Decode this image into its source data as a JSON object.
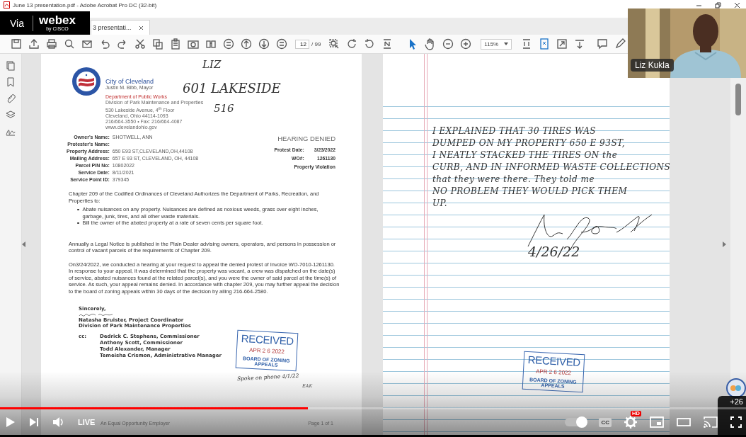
{
  "window": {
    "title": "June 13 presentation.pdf - Adobe Acrobat Pro DC (32-bit)"
  },
  "tab": {
    "label": "3 presentati..."
  },
  "toolbar": {
    "page_number": "12",
    "page_total": "/ 99",
    "zoom": "115%"
  },
  "letter": {
    "org": "City of Cleveland",
    "mayor": "Justin M. Bibb, Mayor",
    "department": "Department of Public Works",
    "address_lines": [
      "Division of Park Maintenance and Properties",
      "530 Lakeside Avenue, 4$^{th}$ Floor",
      "Cleveland, Ohio 44114-1093",
      "216/664-3550 • Fax: 216/664-4087",
      "www.clevelandohio.gov"
    ],
    "handwritten_notes": [
      "LIZ",
      "601 LAKESIDE",
      "516"
    ],
    "fields": [
      {
        "label": "Owner's Name:",
        "value": "SHOTWELL, ANN"
      },
      {
        "label": "Protester's Name:"
      },
      {
        "label": "Property Address:",
        "value": "650 E93 ST,CLEVELAND,OH,44108"
      },
      {
        "label": "Mailing Address:",
        "value": "657 E 93 ST, CLEVELAND, OH, 44108"
      },
      {
        "label": "Parcel PIN No:",
        "value": "10802022"
      },
      {
        "label": "Service Date:",
        "value": "8/11/2021"
      },
      {
        "label": "Service Point ID:",
        "value": "379345"
      }
    ],
    "status": "HEARING DENIED",
    "meta": [
      {
        "label": "Protest Date:",
        "value": "3/23/2022"
      },
      {
        "label": "WO#:",
        "value": "1261130"
      }
    ],
    "violation": "Property Violation",
    "intro": "Chapter 209 of the Codified Ordinances of Cleveland Authorizes the Department of Parks, Recreation, and Properties to:",
    "bullets": [
      "Abate nuisances on any property. Nuisances are defined as noxious weeds, grass over eight inches,  garbage, junk, tires, and all other waste materials.",
      "Bill the owner of the abated property at a rate of seven cents per square foot."
    ],
    "paragraphs": [
      "Annually a Legal Notice is published in the Plain Dealer advising owners, operators, and persons in possession or control of vacant parcels of the requirements of Chapter 209.",
      "On3/24/2022, we conducted a hearing at your request to appeal the denied protest of Invoice  WO-7010-1261130. In response to your appeal,  it was determined that the property was vacant, a crew was dispatched on the date(s) of service, abated nuisances found at the related parcel(s), and you were the owner of said parcel at the time(s) of service. As such, your appeal remains denied. In accordance with chapter 209, you may further appeal the decision to the board of zoning appeals within 30 days of the decision by alling 216-664-2580."
    ],
    "closing": "Sincerely,",
    "signer": "Natasha Bruister, Project Coordinator",
    "division": "Division of Park Maintenance  Properties",
    "cc_label": "cc:",
    "cc": [
      "Dedrick C. Stephens, Commissioner",
      "Anthony Scott, Commissioner",
      "Todd Alexander, Manager",
      "Temeisha Crismon, Administrative Manager"
    ],
    "stamp": {
      "title": "RECEIVED",
      "date": "APR 2 6 2022",
      "board": "BOARD OF ZONING APPEALS"
    },
    "stamp_note": "Spoke on phone 4/1/22",
    "initials": "EAK",
    "footer": {
      "employer": "An Equal Opportunity Employer",
      "page": "Page 1 of 1"
    }
  },
  "note_page": {
    "lines": [
      "I EXPLAINED THAT 30 TIRES WAS",
      "DUMPED ON MY PROPERTY 650 E 93ST,",
      "I NEATLY STACKED THE TIRES ON the",
      "CURB, AND IN INFORMED WASTE COLLECTIONS",
      "that they were there. They told me",
      "NO PROBLEM THEY WOULD PICK THEM",
      "UP."
    ],
    "date": "4/26/22",
    "stamp": {
      "title": "RECEIVED",
      "date": "APR 2 6 2022",
      "board": "BOARD OF ZONING APPEALS"
    }
  },
  "webex": {
    "via": "Via",
    "brand": "webex",
    "by": "by CISCO"
  },
  "webcam": {
    "name": "Liz Kukla"
  },
  "player": {
    "progress": {
      "level": 0.413
    },
    "live": "LIVE",
    "autoplay": {
      "on": true
    },
    "cc": "CC",
    "quality": "HD",
    "viewers": "+26"
  }
}
